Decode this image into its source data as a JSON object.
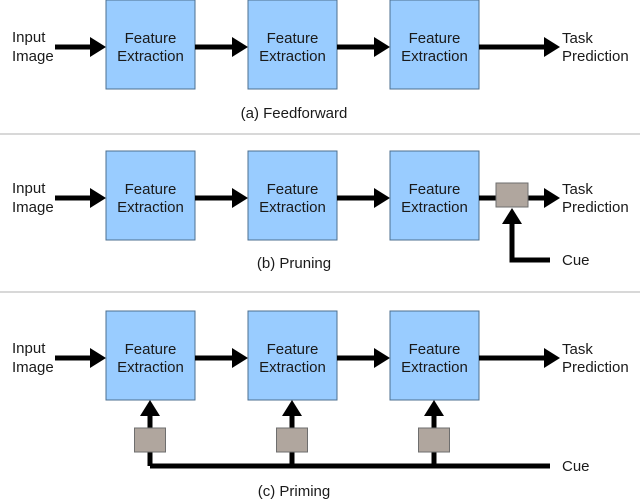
{
  "labels": {
    "input": [
      "Input",
      "Image"
    ],
    "block": [
      "Feature",
      "Extraction"
    ],
    "output": [
      "Task",
      "Prediction"
    ],
    "cue": "Cue"
  },
  "captions": {
    "a": "(a) Feedforward",
    "b": "(b) Pruning",
    "c": "(c) Priming"
  },
  "colors": {
    "block": "#99ccff",
    "gate": "#b0a69e",
    "arrow": "#000000"
  }
}
